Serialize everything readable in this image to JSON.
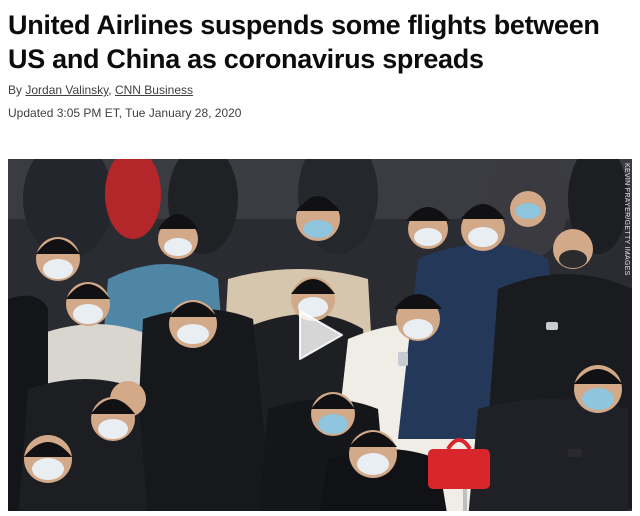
{
  "article": {
    "headline": "United Airlines suspends some flights between US and China as coronavirus spreads",
    "byline_prefix": "By",
    "authors": [
      {
        "name": "Jordan Valinsky"
      },
      {
        "name": "CNN Business"
      }
    ],
    "separator": ", ",
    "updated": "Updated 3:05 PM ET, Tue January 28, 2020"
  },
  "media": {
    "credit": "KEVIN FRAYER/GETTY IMAGES",
    "play_icon": "play-icon",
    "colors": {
      "background": "#2a2c31",
      "mask": "#e9eef3",
      "mask_blue": "#8fc5dd",
      "red_bag": "#d8262c",
      "teal_jacket": "#4f86a6"
    }
  }
}
